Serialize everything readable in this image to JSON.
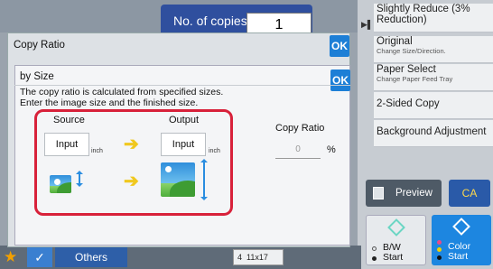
{
  "header": {
    "copies_label": "No. of copies",
    "copies_value": "1"
  },
  "side_menu": {
    "items": [
      {
        "label": "Slightly Reduce (3% Reduction)",
        "sub": ""
      },
      {
        "label": "Original",
        "sub": "Change Size/Direction."
      },
      {
        "label": "Paper Select",
        "sub": "Change Paper Feed Tray"
      },
      {
        "label": "2-Sided Copy",
        "sub": ""
      },
      {
        "label": "Background Adjustment",
        "sub": ""
      }
    ]
  },
  "actions": {
    "preview": "Preview",
    "ca": "CA",
    "bw_start": "B/W Start",
    "color_start": "Color Start"
  },
  "dialog_ratio": {
    "title": "Copy Ratio",
    "ok": "OK"
  },
  "dialog_size": {
    "title": "by Size",
    "ok": "OK",
    "description": "The copy ratio is calculated from specified sizes. Enter the image size and the finished size.",
    "source_label": "Source",
    "output_label": "Output",
    "source_input": "Input",
    "output_input": "Input",
    "unit": "inch",
    "ratio_label": "Copy Ratio",
    "ratio_value": "0",
    "ratio_unit": "%"
  },
  "bottom": {
    "others": "Others",
    "paper_tray": "4",
    "paper_size": "11x17"
  },
  "colors": {
    "accent": "#1d7fd6",
    "highlight": "#d8213a",
    "start_color": "#1d86e0"
  }
}
